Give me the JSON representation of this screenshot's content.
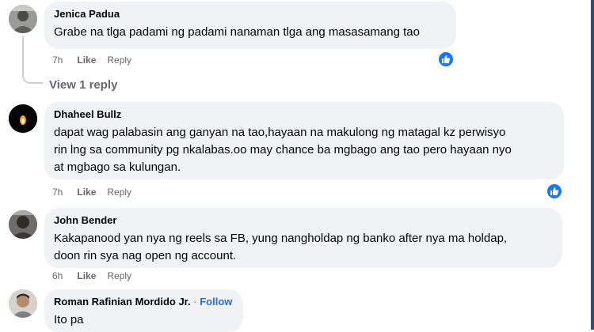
{
  "comments": [
    {
      "author": "Jenica Padua",
      "text": "Grabe na tlga padami ng padami nanaman tlga ang masasamang tao",
      "time": "7h",
      "like": "Like",
      "reply": "Reply",
      "reaction": "like-icon"
    },
    {
      "author": "Dhaheel Bullz",
      "text": "dapat wag palabasin ang ganyan na tao,hayaan na makulong ng matagal kz perwisyo\nrin lng sa community pg nkalabas.oo may chance ba mgbago ang tao pero hayaan nyo\nat mgbago sa kulungan.",
      "time": "7h",
      "like": "Like",
      "reply": "Reply",
      "reaction": "like-icon"
    },
    {
      "author": "John Bender",
      "text": "Kakapanood yan nya ng reels sa FB, yung nangholdap ng banko after nya ma holdap,\ndoon rin sya nag open ng account.",
      "time": "6h",
      "like": "Like",
      "reply": "Reply"
    },
    {
      "author": "Roman Rafinian Mordido Jr.",
      "follow": "Follow",
      "separator": "·",
      "text": "Ito pa"
    }
  ],
  "view_replies": "View 1 reply",
  "colors": {
    "bubble": "#f0f2f5",
    "link": "#216fdb",
    "meta": "#65676b",
    "like_badge": "#1877f2"
  }
}
